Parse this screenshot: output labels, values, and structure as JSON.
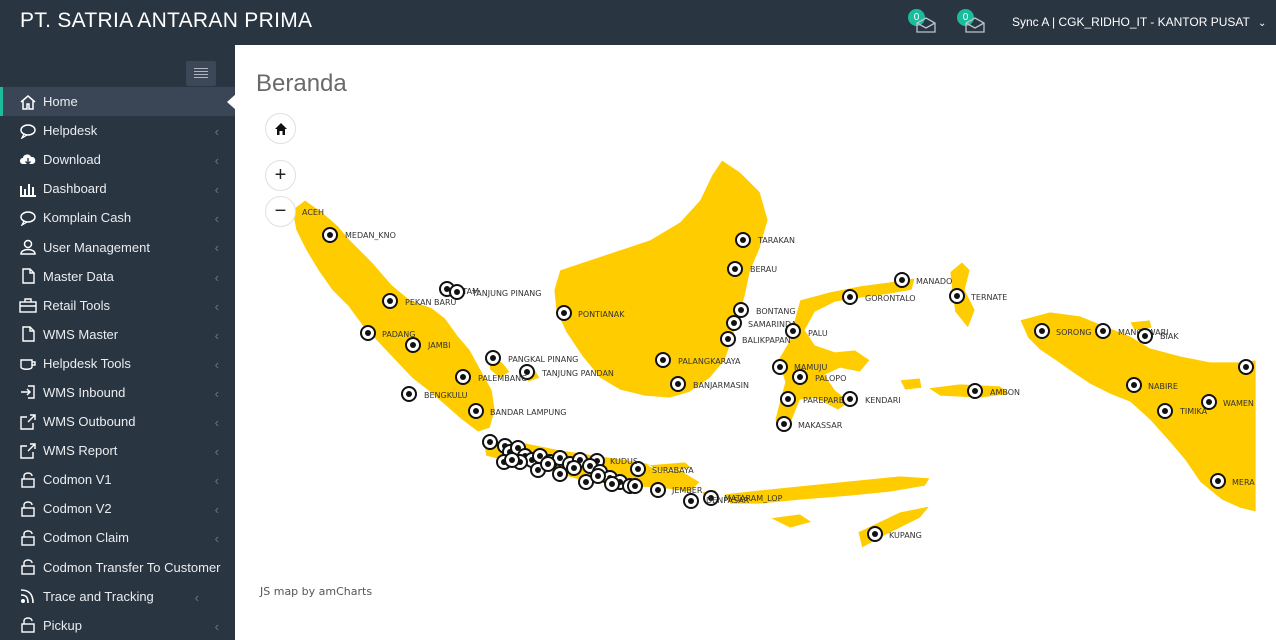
{
  "header": {
    "brand": "PT. SATRIA ANTARAN PRIMA",
    "notifications": [
      {
        "count": "0",
        "icon": "envelope-icon"
      },
      {
        "count": "0",
        "icon": "envelope-icon"
      }
    ],
    "user": "Sync A | CGK_RIDHO_IT - KANTOR PUSAT"
  },
  "sidebar": {
    "items": [
      {
        "label": "Home",
        "icon": "home-icon",
        "active": true
      },
      {
        "label": "Helpdesk",
        "icon": "chat-icon"
      },
      {
        "label": "Download",
        "icon": "download-icon"
      },
      {
        "label": "Dashboard",
        "icon": "bar-chart-icon"
      },
      {
        "label": "Komplain Cash",
        "icon": "chat-icon"
      },
      {
        "label": "User Management",
        "icon": "user-icon"
      },
      {
        "label": "Master Data",
        "icon": "document-icon"
      },
      {
        "label": "Retail Tools",
        "icon": "toolbox-icon"
      },
      {
        "label": "WMS Master",
        "icon": "document-icon"
      },
      {
        "label": "Helpdesk Tools",
        "icon": "coffee-icon"
      },
      {
        "label": "WMS Inbound",
        "icon": "sign-in-icon"
      },
      {
        "label": "WMS Outbound",
        "icon": "external-link-icon"
      },
      {
        "label": "WMS Report",
        "icon": "external-link-icon"
      },
      {
        "label": "Codmon V1",
        "icon": "lock-icon"
      },
      {
        "label": "Codmon V2",
        "icon": "lock-icon"
      },
      {
        "label": "Codmon Claim",
        "icon": "lock-icon"
      },
      {
        "label": "Codmon Transfer To Customer",
        "icon": "lock-icon"
      },
      {
        "label": "Trace and Tracking",
        "icon": "rss-icon"
      },
      {
        "label": "Pickup",
        "icon": "lock-icon"
      }
    ]
  },
  "main": {
    "title": "Beranda",
    "credit": "JS map by amCharts",
    "zoom_in": "+",
    "zoom_out": "−"
  },
  "colors": {
    "land": "#ffcc00",
    "accent": "#1abc9c",
    "topbar": "#2a3542"
  },
  "map_labels": {
    "aceh": "ACEH",
    "medan": "MEDAN_KNO",
    "batam": "BATAM",
    "tanjungpinang": "TANJUNG PINANG",
    "pekanbaru": "PEKAN BARU",
    "padang": "PADANG",
    "jambi": "JAMBI",
    "pangkalpinang": "PANGKAL PINANG",
    "tanjungpandan": "TANJUNG PANDAN",
    "palembang": "PALEMBANG",
    "bengkulu": "BENGKULU",
    "bandarlampung": "BANDAR LAMPUNG",
    "pontianak": "PONTIANAK",
    "palangkaraya": "PALANGKARAYA",
    "banjarmasin": "BANJARMASIN",
    "tarakan": "TARAKAN",
    "berau": "BERAU",
    "bontang": "BONTANG",
    "samarinda": "SAMARINDA",
    "balikpapan": "BALIKPAPAN",
    "palu": "PALU",
    "mamuju": "MAMUJU",
    "palopo": "PALOPO",
    "parepare": "PAREPARE",
    "kendari": "KENDARI",
    "makassar": "MAKASSAR",
    "gorontalo": "GORONTALO",
    "manado": "MANADO",
    "ternate": "TERNATE",
    "ambon": "AMBON",
    "sorong": "SORONG",
    "manokwari": "MANOKWARI",
    "biak": "BIAK",
    "nabire": "NABIRE",
    "timika": "TIMIKA",
    "wamena": "WAMEN",
    "merauke": "MERA",
    "kupang": "KUPANG",
    "surabaya": "SURABAYA",
    "jember": "JEMBER",
    "mataram": "MATARAM_LOP",
    "denpasar": "DENPASAR",
    "kudus": "KUDUS"
  }
}
